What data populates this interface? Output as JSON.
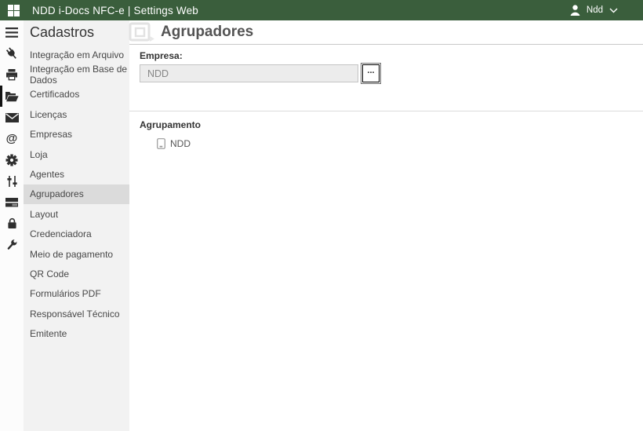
{
  "topbar": {
    "title": "NDD i-Docs NFC-e | Settings Web",
    "user_label": "Ndd"
  },
  "icons": {
    "apps_grid": "four-square-grid",
    "user": "person-silhouette",
    "user_chevron": "chevron-down",
    "rail": [
      "hamburger-menu",
      "plug",
      "printer",
      "folder-open",
      "envelope",
      "at-sign",
      "gear",
      "sliders",
      "server-list",
      "lock",
      "wrench"
    ],
    "at_symbol": "@",
    "page_header": "group-frame",
    "tree_node": "tablet-outline"
  },
  "menu": {
    "title": "Cadastros",
    "selected_item": "Agrupadores",
    "items": [
      {
        "label": "Integração em Arquivo",
        "selected": false
      },
      {
        "label": "Integração em Base de Dados",
        "selected": false
      },
      {
        "label": "Certificados",
        "selected": false
      },
      {
        "label": "Licenças",
        "selected": false
      },
      {
        "label": "Empresas",
        "selected": false
      },
      {
        "label": "Loja",
        "selected": false
      },
      {
        "label": "Agentes",
        "selected": false
      },
      {
        "label": "Agrupadores",
        "selected": true
      },
      {
        "label": "Layout",
        "selected": false
      },
      {
        "label": "Credenciadora",
        "selected": false
      },
      {
        "label": "Meio de pagamento",
        "selected": false
      },
      {
        "label": "QR Code",
        "selected": false
      },
      {
        "label": "Formulários PDF",
        "selected": false
      },
      {
        "label": "Responsável Técnico",
        "selected": false
      },
      {
        "label": "Emitente",
        "selected": false
      }
    ]
  },
  "main": {
    "title": "Agrupadores",
    "empresa_label": "Empresa:",
    "empresa_value": "NDD",
    "browse_label": "...",
    "agrupamento_label": "Agrupamento",
    "tree_items": [
      {
        "label": "NDD"
      }
    ]
  },
  "colors": {
    "topbar_bg": "#3a5e3c",
    "rail_bg": "#fcfcfc",
    "menu_bg": "#f2f2f2",
    "menu_selected_bg": "#dbdbdb",
    "input_bg": "#ececec",
    "divider": "#dcdcdc"
  }
}
